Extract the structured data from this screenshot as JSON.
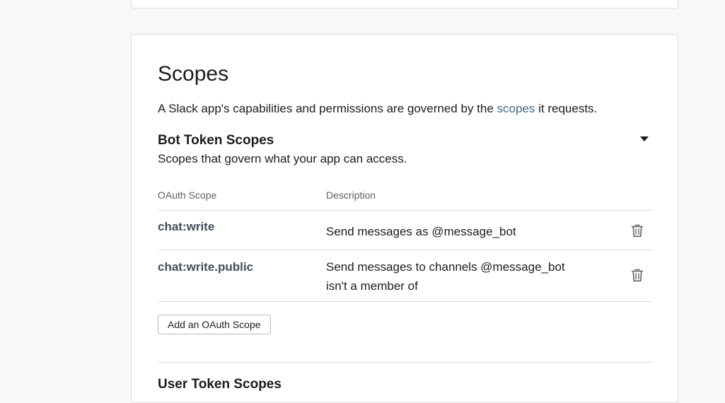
{
  "section": {
    "title": "Scopes",
    "description_prefix": "A Slack app's capabilities and permissions are governed by the ",
    "description_link": "scopes",
    "description_suffix": " it requests."
  },
  "bot_scopes": {
    "heading": "Bot Token Scopes",
    "subheading": "Scopes that govern what your app can access.",
    "col_scope": "OAuth Scope",
    "col_description": "Description",
    "rows": [
      {
        "scope": "chat:write",
        "description": "Send messages as @message_bot"
      },
      {
        "scope": "chat:write.public",
        "description": "Send messages to channels @message_bot isn't a member of"
      }
    ],
    "add_button": "Add an OAuth Scope"
  },
  "next_section": {
    "heading": "User Token Scopes"
  },
  "colors": {
    "link": "#3f6a8a",
    "scope_text": "#3f4d5a",
    "border": "#dddddd"
  }
}
